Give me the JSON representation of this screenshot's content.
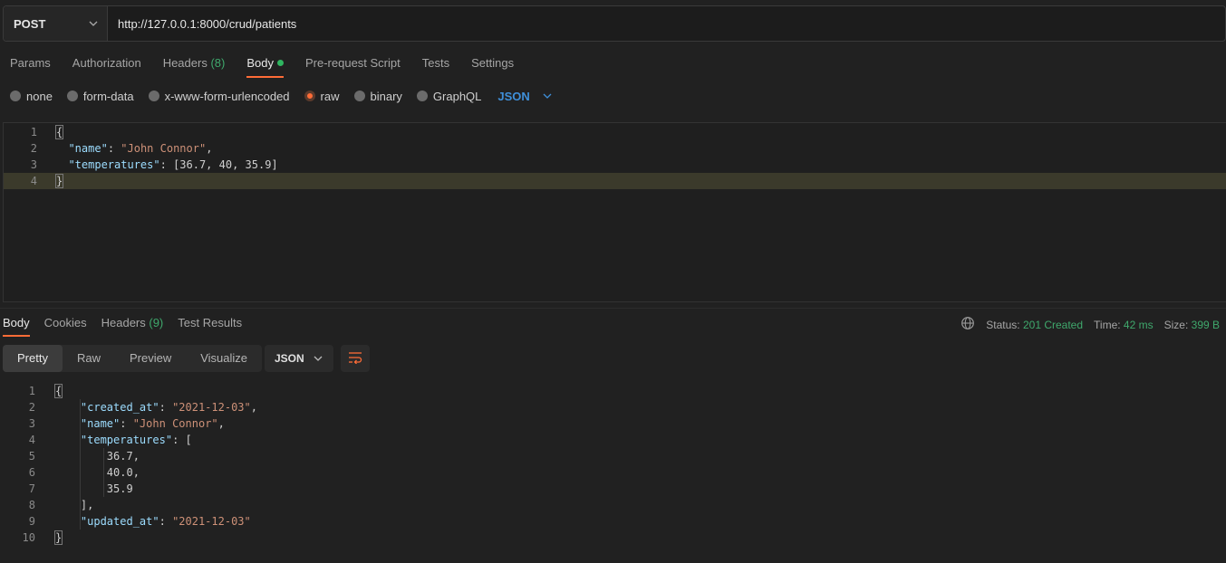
{
  "request": {
    "method": "POST",
    "url": "http://127.0.0.1:8000/crud/patients"
  },
  "request_tabs": [
    {
      "label": "Params"
    },
    {
      "label": "Authorization"
    },
    {
      "label": "Headers",
      "count": "(8)"
    },
    {
      "label": "Body",
      "active": true
    },
    {
      "label": "Pre-request Script"
    },
    {
      "label": "Tests"
    },
    {
      "label": "Settings"
    }
  ],
  "body_types": [
    "none",
    "form-data",
    "x-www-form-urlencoded",
    "raw",
    "binary",
    "GraphQL"
  ],
  "body_type_selected": "raw",
  "body_language": "JSON",
  "request_body": {
    "line_numbers": [
      "1",
      "2",
      "3",
      "4"
    ],
    "open_brace": "{",
    "name_key": "\"name\"",
    "name_value": "\"John Connor\"",
    "temps_key": "\"temperatures\"",
    "temps_value": "[36.7, 40, 35.9]",
    "close_brace": "}"
  },
  "response_tabs": [
    {
      "label": "Body",
      "active": true
    },
    {
      "label": "Cookies"
    },
    {
      "label": "Headers",
      "count": "(9)"
    },
    {
      "label": "Test Results"
    }
  ],
  "response_status": {
    "status_label": "Status:",
    "status_value": "201 Created",
    "time_label": "Time:",
    "time_value": "42 ms",
    "size_label": "Size:",
    "size_value": "399 B"
  },
  "view_modes": [
    "Pretty",
    "Raw",
    "Preview",
    "Visualize"
  ],
  "view_mode_active": "Pretty",
  "response_format": "JSON",
  "response_body": {
    "line_numbers": [
      "1",
      "2",
      "3",
      "4",
      "5",
      "6",
      "7",
      "8",
      "9",
      "10"
    ],
    "open_brace": "{",
    "created_key": "\"created_at\"",
    "created_value": "\"2021-12-03\"",
    "name_key": "\"name\"",
    "name_value": "\"John Connor\"",
    "temps_key": "\"temperatures\"",
    "temps_open": "[",
    "t1": "36.7,",
    "t2": "40.0,",
    "t3": "35.9",
    "temps_close": "],",
    "updated_key": "\"updated_at\"",
    "updated_value": "\"2021-12-03\"",
    "close_brace": "}"
  },
  "colors": {
    "accent": "#ff6c37",
    "success": "#3fa86c",
    "link": "#3f8fd9"
  }
}
